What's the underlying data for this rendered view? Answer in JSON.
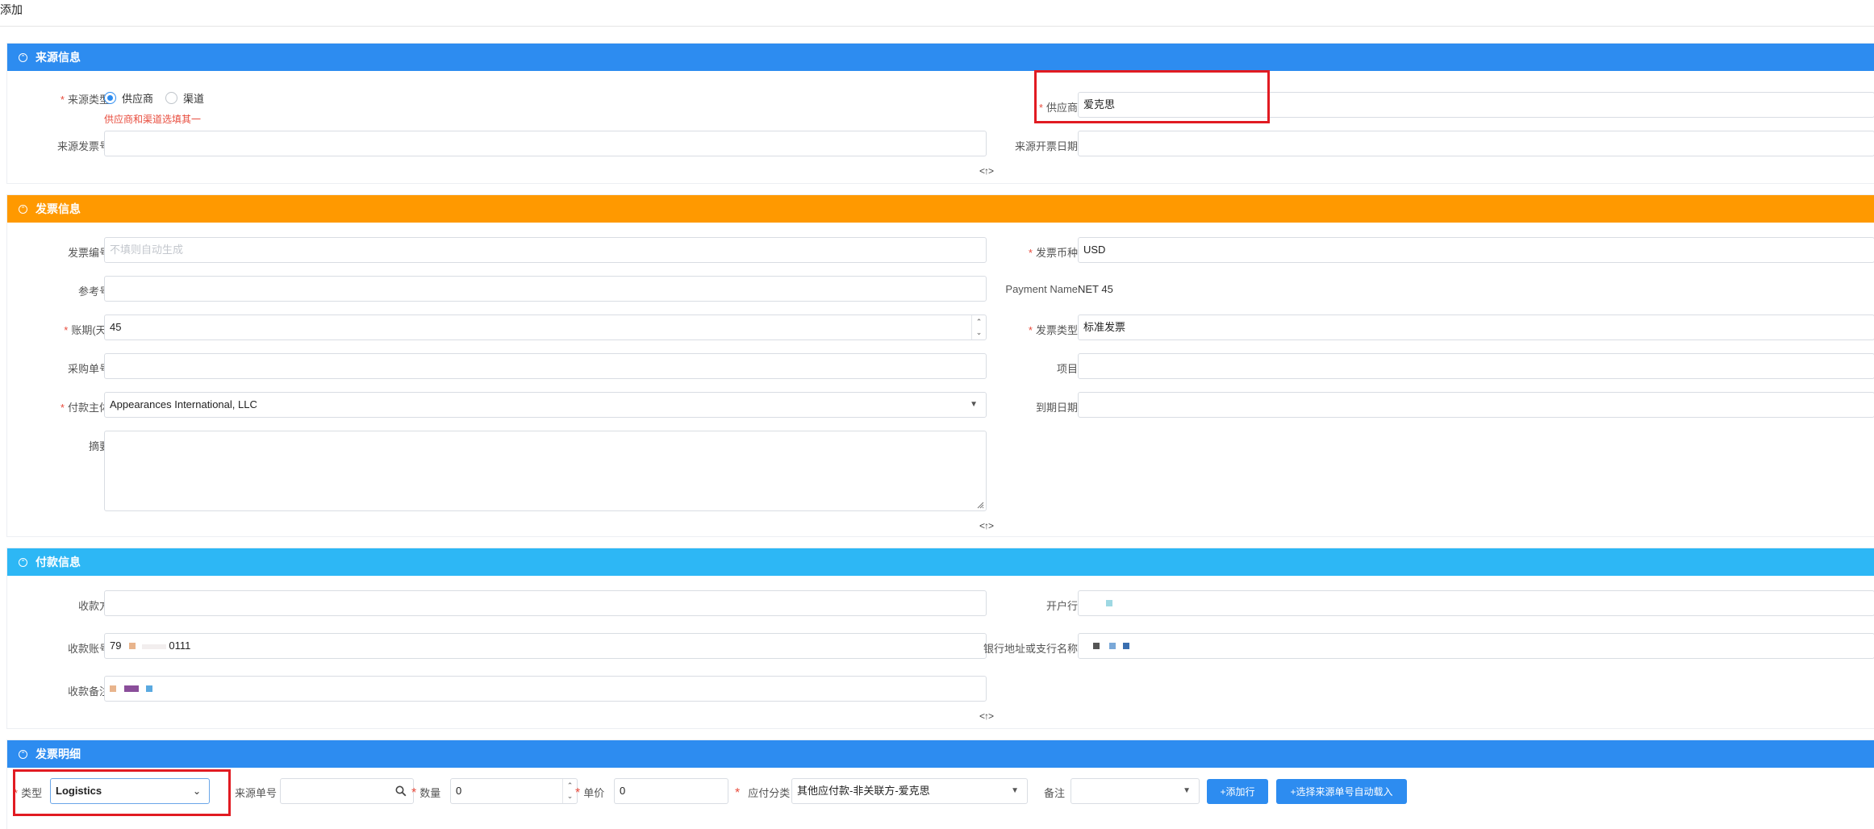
{
  "page": {
    "title": "添加"
  },
  "colors": {
    "source": "#2d8cf0",
    "invoice": "#ff9900",
    "payment": "#2db7f5",
    "detail": "#2d8cf0",
    "required": "#e84c3d",
    "highlight": "#e11b22"
  },
  "collapse_label": "<↑>",
  "source_section": {
    "title": "来源信息",
    "source_type_label": "来源类型",
    "options": [
      "供应商",
      "渠道"
    ],
    "selected_option": "供应商",
    "validation_msg": "供应商和渠道选填其一",
    "supplier_label": "供应商",
    "supplier_value": "爱克思",
    "source_invoice_no_label": "来源发票号",
    "source_invoice_no_value": "",
    "source_invoice_date_label": "来源开票日期",
    "source_invoice_date_value": ""
  },
  "invoice_section": {
    "title": "发票信息",
    "invoice_no_label": "发票编号",
    "invoice_no_placeholder": "不填则自动生成",
    "currency_label": "发票币种",
    "currency_value": "USD",
    "ref_no_label": "参考号",
    "ref_no_value": "",
    "payment_name_label": "Payment Name",
    "payment_name_value": "NET 45",
    "term_label": "账期(天)",
    "term_value": "45",
    "invoice_type_label": "发票类型",
    "invoice_type_value": "标准发票",
    "po_no_label": "采购单号",
    "po_no_value": "",
    "project_label": "项目",
    "project_value": "",
    "payer_label": "付款主体",
    "payer_value": "Appearances International, LLC",
    "due_date_label": "到期日期",
    "due_date_value": "",
    "summary_label": "摘要",
    "summary_value": ""
  },
  "payment_section": {
    "title": "付款信息",
    "payee_label": "收款方",
    "payee_value": "",
    "bank_label": "开户行",
    "bank_value": "",
    "account_label": "收款账号",
    "account_value_start": "79",
    "account_value_end": "0111",
    "bank_address_label": "银行地址或支行名称",
    "bank_address_value": "",
    "remark_label": "收款备注",
    "remark_value": ""
  },
  "detail_section": {
    "title": "发票明细",
    "type_label": "类型",
    "type_value": "Logistics",
    "source_no_label": "来源单号",
    "source_no_value": "",
    "qty_label": "数量",
    "qty_value": "0",
    "price_label": "单价",
    "price_value": "0",
    "category_label": "应付分类",
    "category_value": "其他应付款-非关联方-爱克思",
    "note_label": "备注",
    "note_value": "",
    "add_row_label": "+添加行",
    "auto_load_label": "+选择来源单号自动载入"
  }
}
